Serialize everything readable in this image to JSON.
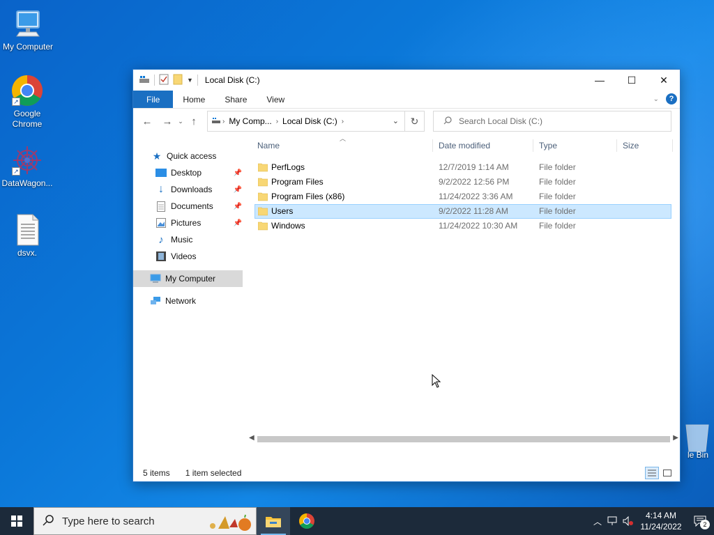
{
  "desktop": {
    "icons": [
      {
        "label": "My Computer",
        "icon": "computer-icon"
      },
      {
        "label": "Google Chrome",
        "icon": "chrome-icon"
      },
      {
        "label": "DataWagon...",
        "icon": "datawagon-icon"
      },
      {
        "label": "dsvx.",
        "icon": "text-file-icon"
      },
      {
        "label": "le Bin",
        "icon": "recycle-bin-icon"
      }
    ]
  },
  "window": {
    "title": "Local Disk (C:)",
    "controls": {
      "minimize": "—",
      "maximize": "☐",
      "close": "✕"
    },
    "ribbon_tabs": [
      "File",
      "Home",
      "Share",
      "View"
    ],
    "address": {
      "segments": [
        "My Comp...",
        "Local Disk (C:)"
      ]
    },
    "search": {
      "placeholder": "Search Local Disk (C:)"
    },
    "nav_pane": [
      {
        "label": "Quick access",
        "icon": "star-icon",
        "pinned": false
      },
      {
        "label": "Desktop",
        "icon": "desktop-icon",
        "pinned": true
      },
      {
        "label": "Downloads",
        "icon": "download-icon",
        "pinned": true
      },
      {
        "label": "Documents",
        "icon": "documents-icon",
        "pinned": true
      },
      {
        "label": "Pictures",
        "icon": "pictures-icon",
        "pinned": true
      },
      {
        "label": "Music",
        "icon": "music-icon",
        "pinned": false
      },
      {
        "label": "Videos",
        "icon": "videos-icon",
        "pinned": false
      },
      {
        "label": "My Computer",
        "icon": "computer-icon",
        "selected": true
      },
      {
        "label": "Network",
        "icon": "network-icon"
      }
    ],
    "columns": [
      "Name",
      "Date modified",
      "Type",
      "Size"
    ],
    "files": [
      {
        "name": "PerfLogs",
        "date": "12/7/2019 1:14 AM",
        "type": "File folder"
      },
      {
        "name": "Program Files",
        "date": "9/2/2022 12:56 PM",
        "type": "File folder"
      },
      {
        "name": "Program Files (x86)",
        "date": "11/24/2022 3:36 AM",
        "type": "File folder"
      },
      {
        "name": "Users",
        "date": "9/2/2022 11:28 AM",
        "type": "File folder",
        "selected": true
      },
      {
        "name": "Windows",
        "date": "11/24/2022 10:30 AM",
        "type": "File folder"
      }
    ],
    "status": {
      "items": "5 items",
      "selection": "1 item selected"
    }
  },
  "taskbar": {
    "search_placeholder": "Type here to search",
    "apps": [
      "file-explorer-icon",
      "chrome-icon"
    ],
    "clock": {
      "time": "4:14 AM",
      "date": "11/24/2022"
    },
    "notification_count": "2"
  },
  "colors": {
    "accent": "#1a6fc2",
    "selection": "#cce8ff",
    "folder": "#f8d775",
    "taskbar": "#1c2a3a"
  }
}
